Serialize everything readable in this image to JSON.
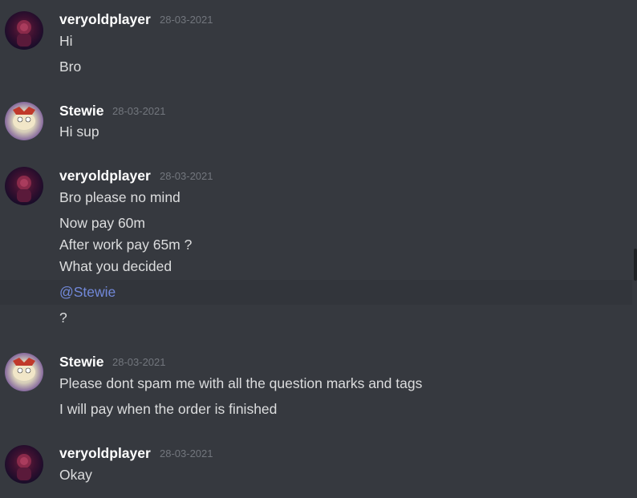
{
  "users": {
    "veryoldplayer": "veryoldplayer",
    "stewie": "Stewie"
  },
  "groups": [
    {
      "author": "veryoldplayer",
      "timestamp": "28-03-2021",
      "messages": [
        "Hi",
        "Bro"
      ]
    },
    {
      "author": "Stewie",
      "timestamp": "28-03-2021",
      "messages": [
        "Hi sup"
      ]
    },
    {
      "author": "veryoldplayer",
      "timestamp": "28-03-2021",
      "messages": [
        "Bro please no mind",
        "Now pay 60m",
        "After work pay 65m ?",
        "What you decided",
        "@Stewie",
        "?"
      ]
    },
    {
      "author": "Stewie",
      "timestamp": "28-03-2021",
      "messages": [
        "Please dont spam me with all the question marks and tags",
        "I will pay when the order is finished"
      ]
    },
    {
      "author": "veryoldplayer",
      "timestamp": "28-03-2021",
      "messages": [
        "Okay"
      ]
    }
  ],
  "icons": {
    "veryoldplayer_avatar": "avatar-veryoldplayer-icon",
    "stewie_avatar": "avatar-stewie-icon"
  },
  "colors": {
    "background": "#36393f",
    "mention": "#7289da",
    "username": "#ffffff",
    "timestamp": "#72767d",
    "text": "#dcddde"
  }
}
